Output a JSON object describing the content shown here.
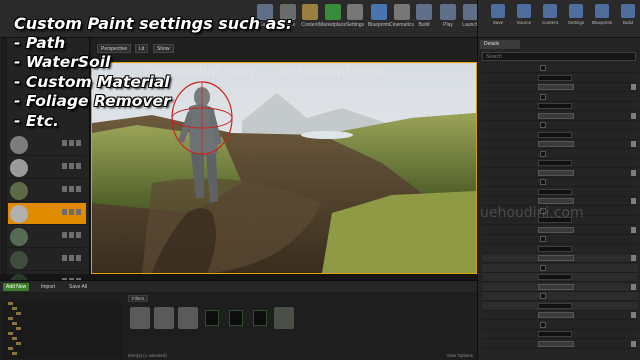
{
  "overlay": {
    "lines": [
      "Custom Paint settings such as:",
      "- Path",
      "- WaterSoil",
      "- Custom Material",
      "- Foliage Remover",
      "- Etc."
    ]
  },
  "watermark": "uehoudini.com",
  "toolbar": {
    "buttons": [
      {
        "label": "Save",
        "icon": "save-icon",
        "color": "#5f6f88"
      },
      {
        "label": "Source",
        "icon": "source-control-icon",
        "color": "#6b6b6b"
      },
      {
        "label": "Content",
        "icon": "content-icon",
        "color": "#9a7f40"
      },
      {
        "label": "Marketplace",
        "icon": "marketplace-icon",
        "color": "#3a8c3a"
      },
      {
        "label": "Settings",
        "icon": "gear-icon",
        "color": "#777777"
      },
      {
        "label": "Blueprints",
        "icon": "blueprint-icon",
        "color": "#4a74b0"
      },
      {
        "label": "Cinematics",
        "icon": "cinematics-icon",
        "color": "#777777"
      },
      {
        "label": "Build",
        "icon": "build-icon",
        "color": "#5f6f88"
      },
      {
        "label": "Play",
        "icon": "play-icon",
        "color": "#5f6f88"
      },
      {
        "label": "Launch",
        "icon": "launch-icon",
        "color": "#5f6f88"
      }
    ]
  },
  "viewport": {
    "chips": [
      "Perspective",
      "Lit",
      "Show"
    ],
    "accent": "#e0a400"
  },
  "left_panel": {
    "items": [
      {
        "name": "",
        "thumb": "#7d7d7d"
      },
      {
        "name": "",
        "thumb": "#9a9a9a"
      },
      {
        "name": "",
        "thumb": "#5c6a48"
      },
      {
        "name": "",
        "thumb": "#b0b0b0",
        "selected": true
      },
      {
        "name": "",
        "thumb": "#556b54"
      },
      {
        "name": "",
        "thumb": "#3e4d3e"
      },
      {
        "name": "",
        "thumb": "#2a3a2a"
      }
    ],
    "selected_color": "#e08a00"
  },
  "right_panel": {
    "details_tab": "Details",
    "search_placeholder": "Search",
    "buttons": [
      "Save",
      "Source",
      "Content",
      "Settings",
      "Blueprints",
      "Build"
    ]
  },
  "bottom": {
    "add_new_label": "Add New",
    "import_label": "Import",
    "save_all_label": "Save All",
    "filters": [
      "Filters"
    ],
    "status": "Item(s) (1 selected)",
    "view_options": "View Options"
  }
}
